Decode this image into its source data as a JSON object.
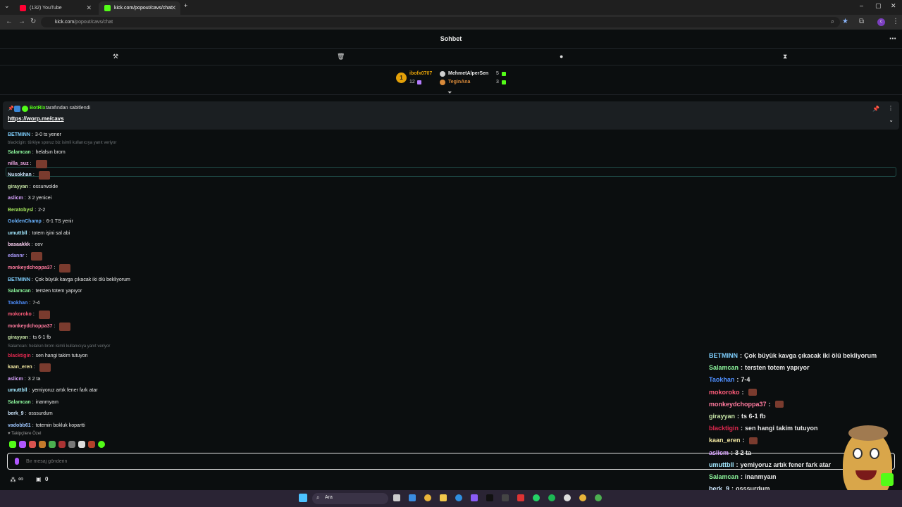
{
  "browser": {
    "tabs": [
      {
        "title": "(132) YouTube",
        "favicon_color": "#ff0033"
      },
      {
        "title": "kick.com/popout/cavs/chat",
        "favicon_color": "#53fc18"
      }
    ],
    "url_domain": "kick.com",
    "url_path": "/popout/cavs/chat",
    "profile_initial": "c"
  },
  "chat": {
    "title": "Sohbet",
    "leaderboard": {
      "rank1": {
        "rank": "1",
        "name": "ibofx0707",
        "count": "12"
      },
      "rank2": {
        "name": "MehmetAlperSen",
        "count": "5"
      },
      "rank3": {
        "name": "TeginAna",
        "count": "3"
      }
    },
    "pinned": {
      "by_user": "BotRix",
      "by_text": "tarafından sabitlendi",
      "link": "https://worp.me/cavs"
    },
    "messages": [
      {
        "user": "BETMINN",
        "text": "3-0 ts yener",
        "color": "#7fd0ff"
      },
      {
        "reply": "blacktigin: türkiye sporuz biz isimli kullanıcıya yanıt veriyor"
      },
      {
        "user": "Salamcan",
        "text": "helalsın brom",
        "color": "#8cf59c"
      },
      {
        "user": "nilla_suz",
        "text": "",
        "color": "#f2a9e8"
      },
      {
        "user": "Nusokhan",
        "text": "",
        "color": "#cde6ff"
      },
      {
        "user": "girayyan",
        "text": "ossurwolde",
        "color": "#c8e6a8"
      },
      {
        "user": "aslicm",
        "text": "3 2 yenicei",
        "color": "#d9a3ff"
      },
      {
        "user": "Beratobysl",
        "text": "2-2",
        "color": "#a6e85c"
      },
      {
        "user": "GoldenChamp",
        "text": "6-1 TS yenir",
        "color": "#6ab3ff"
      },
      {
        "user": "umuttbll",
        "text": "totem işini sal abi",
        "color": "#a3e8ff"
      },
      {
        "user": "basaakkk",
        "text": "oov",
        "color": "#ffd2f5"
      },
      {
        "user": "edannr",
        "text": "",
        "color": "#ad9cff"
      },
      {
        "user": "monkeydchoppa37",
        "text": "",
        "color": "#ff7a9e"
      },
      {
        "user": "BETMINN",
        "text": "Çok büyük kavga çıkacak iki ölü bekliyorum",
        "color": "#7fd0ff"
      },
      {
        "user": "Salamcan",
        "text": "tersten totem yapıyor",
        "color": "#8cf59c"
      },
      {
        "user": "Taokhan",
        "text": "7-4",
        "color": "#4f8fff"
      },
      {
        "user": "mokoroko",
        "text": "",
        "color": "#ff5c7a"
      },
      {
        "user": "monkeydchoppa37",
        "text": "",
        "color": "#ff7a9e"
      },
      {
        "user": "girayyan",
        "text": "ts 6-1 fb",
        "color": "#c8e6a8"
      },
      {
        "reply": "Salamcan: helalsın brom isimli kullanıcıya yanıt veriyor"
      },
      {
        "user": "blacktigin",
        "text": "sen hangi takim tutuyon",
        "color": "#e0284f"
      },
      {
        "user": "kaan_eren",
        "text": "",
        "color": "#f0e6a0"
      },
      {
        "user": "aslicm",
        "text": "3 2 ta",
        "color": "#d9a3ff"
      },
      {
        "user": "umuttbll",
        "text": "yemiyoruz artık fener fark atar",
        "color": "#a3e8ff"
      },
      {
        "user": "Salamcan",
        "text": "inanmyaın",
        "color": "#8cf59c"
      },
      {
        "user": "berk_9",
        "text": "osssurdum",
        "color": "#cfe8ff"
      },
      {
        "user": "vadobb61",
        "text": "totemin bokluk kopartti",
        "color": "#9ec7ff"
      }
    ],
    "followers_label": "Takipçilere Özel",
    "input_placeholder": "Bir mesaj gönderin",
    "infinity": "∞",
    "counter": "0"
  },
  "overlay": {
    "messages": [
      {
        "user": "BETMINN",
        "text": "Çok büyük kavga çıkacak iki ölü bekliyorum",
        "color": "#7fd0ff"
      },
      {
        "user": "Salamcan",
        "text": "tersten totem yapıyor",
        "color": "#8cf59c"
      },
      {
        "user": "Taokhan",
        "text": "7-4",
        "color": "#4f8fff"
      },
      {
        "user": "mokoroko",
        "text": "",
        "color": "#ff5c7a"
      },
      {
        "user": "monkeydchoppa37",
        "text": "",
        "color": "#ff7a9e"
      },
      {
        "user": "girayyan",
        "text": "ts 6-1 fb",
        "color": "#c8e6a8"
      },
      {
        "user": "blacktigin",
        "text": "sen hangi takim tutuyon",
        "color": "#e0284f"
      },
      {
        "user": "kaan_eren",
        "text": "",
        "color": "#f0e6a0"
      },
      {
        "user": "aslicm",
        "text": "3 2 ta",
        "color": "#d9a3ff"
      },
      {
        "user": "umuttbll",
        "text": "yemiyoruz artık fener fark atar",
        "color": "#a3e8ff"
      },
      {
        "user": "Salamcan",
        "text": "inanmyaın",
        "color": "#8cf59c"
      },
      {
        "user": "berk_9",
        "text": "osssurdum",
        "color": "#cfe8ff"
      },
      {
        "user": "vadobb61",
        "text": "totemin bokluk kopartti",
        "color": "#9ec7ff"
      }
    ]
  },
  "taskbar": {
    "search_label": "Ara"
  },
  "colors": {
    "accent": "#53fc18",
    "background": "#0b0e0f"
  }
}
